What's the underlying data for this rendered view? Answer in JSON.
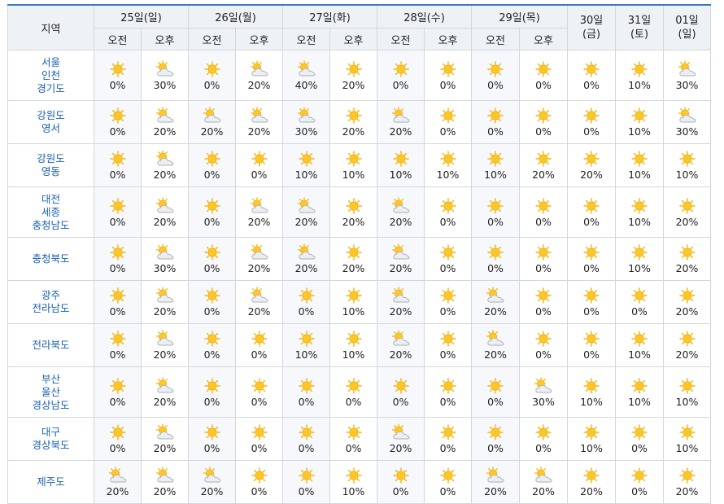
{
  "header": {
    "region_label": "지역",
    "days": [
      {
        "label": "25일(일)",
        "am": "오전",
        "pm": "오후"
      },
      {
        "label": "26일(월)",
        "am": "오전",
        "pm": "오후"
      },
      {
        "label": "27일(화)",
        "am": "오전",
        "pm": "오후"
      },
      {
        "label": "28일(수)",
        "am": "오전",
        "pm": "오후"
      },
      {
        "label": "29일(목)",
        "am": "오전",
        "pm": "오후"
      }
    ],
    "week_days": [
      {
        "top": "30일",
        "bottom": "(금)"
      },
      {
        "top": "31일",
        "bottom": "(토)"
      },
      {
        "top": "01일",
        "bottom": "(일)"
      }
    ]
  },
  "icon_legend": {
    "sun": "sunny-icon",
    "cloudsun": "partly-cloudy-icon"
  },
  "colors": {
    "accent": "#3a78c2",
    "region_text": "#1a5fb4",
    "sun": "#f5b700",
    "cloud": "#c8ccd2"
  },
  "rows": [
    {
      "region": [
        "서울",
        "인천",
        "경기도"
      ],
      "cells": [
        [
          "sun",
          "0%"
        ],
        [
          "cloudsun",
          "30%"
        ],
        [
          "sun",
          "0%"
        ],
        [
          "cloudsun",
          "20%"
        ],
        [
          "cloudsun",
          "40%"
        ],
        [
          "sun",
          "20%"
        ],
        [
          "sun",
          "0%"
        ],
        [
          "sun",
          "0%"
        ],
        [
          "sun",
          "0%"
        ],
        [
          "sun",
          "0%"
        ],
        [
          "sun",
          "0%"
        ],
        [
          "sun",
          "10%"
        ],
        [
          "cloudsun",
          "30%"
        ]
      ]
    },
    {
      "region": [
        "강원도",
        "영서"
      ],
      "cells": [
        [
          "sun",
          "0%"
        ],
        [
          "cloudsun",
          "20%"
        ],
        [
          "cloudsun",
          "20%"
        ],
        [
          "cloudsun",
          "20%"
        ],
        [
          "cloudsun",
          "30%"
        ],
        [
          "sun",
          "20%"
        ],
        [
          "cloudsun",
          "20%"
        ],
        [
          "sun",
          "0%"
        ],
        [
          "sun",
          "0%"
        ],
        [
          "sun",
          "0%"
        ],
        [
          "sun",
          "0%"
        ],
        [
          "sun",
          "10%"
        ],
        [
          "cloudsun",
          "30%"
        ]
      ]
    },
    {
      "region": [
        "강원도",
        "영동"
      ],
      "cells": [
        [
          "sun",
          "0%"
        ],
        [
          "cloudsun",
          "20%"
        ],
        [
          "sun",
          "0%"
        ],
        [
          "sun",
          "0%"
        ],
        [
          "sun",
          "10%"
        ],
        [
          "sun",
          "10%"
        ],
        [
          "sun",
          "10%"
        ],
        [
          "sun",
          "10%"
        ],
        [
          "sun",
          "10%"
        ],
        [
          "sun",
          "20%"
        ],
        [
          "sun",
          "20%"
        ],
        [
          "sun",
          "10%"
        ],
        [
          "sun",
          "10%"
        ]
      ]
    },
    {
      "region": [
        "대전",
        "세종",
        "충청남도"
      ],
      "cells": [
        [
          "sun",
          "0%"
        ],
        [
          "cloudsun",
          "20%"
        ],
        [
          "sun",
          "0%"
        ],
        [
          "cloudsun",
          "20%"
        ],
        [
          "cloudsun",
          "20%"
        ],
        [
          "sun",
          "20%"
        ],
        [
          "cloudsun",
          "20%"
        ],
        [
          "sun",
          "0%"
        ],
        [
          "sun",
          "0%"
        ],
        [
          "sun",
          "0%"
        ],
        [
          "sun",
          "0%"
        ],
        [
          "sun",
          "10%"
        ],
        [
          "sun",
          "20%"
        ]
      ]
    },
    {
      "region": [
        "충청북도"
      ],
      "cells": [
        [
          "sun",
          "0%"
        ],
        [
          "cloudsun",
          "30%"
        ],
        [
          "sun",
          "0%"
        ],
        [
          "cloudsun",
          "20%"
        ],
        [
          "cloudsun",
          "20%"
        ],
        [
          "sun",
          "20%"
        ],
        [
          "cloudsun",
          "20%"
        ],
        [
          "sun",
          "0%"
        ],
        [
          "sun",
          "0%"
        ],
        [
          "sun",
          "0%"
        ],
        [
          "sun",
          "0%"
        ],
        [
          "sun",
          "10%"
        ],
        [
          "sun",
          "20%"
        ]
      ]
    },
    {
      "region": [
        "광주",
        "전라남도"
      ],
      "cells": [
        [
          "sun",
          "0%"
        ],
        [
          "cloudsun",
          "20%"
        ],
        [
          "sun",
          "0%"
        ],
        [
          "cloudsun",
          "20%"
        ],
        [
          "sun",
          "0%"
        ],
        [
          "sun",
          "10%"
        ],
        [
          "cloudsun",
          "20%"
        ],
        [
          "sun",
          "0%"
        ],
        [
          "cloudsun",
          "20%"
        ],
        [
          "sun",
          "0%"
        ],
        [
          "sun",
          "0%"
        ],
        [
          "sun",
          "0%"
        ],
        [
          "sun",
          "20%"
        ]
      ]
    },
    {
      "region": [
        "전라북도"
      ],
      "cells": [
        [
          "sun",
          "0%"
        ],
        [
          "cloudsun",
          "20%"
        ],
        [
          "sun",
          "0%"
        ],
        [
          "sun",
          "0%"
        ],
        [
          "sun",
          "10%"
        ],
        [
          "sun",
          "10%"
        ],
        [
          "cloudsun",
          "20%"
        ],
        [
          "sun",
          "0%"
        ],
        [
          "cloudsun",
          "20%"
        ],
        [
          "sun",
          "0%"
        ],
        [
          "sun",
          "0%"
        ],
        [
          "sun",
          "10%"
        ],
        [
          "sun",
          "20%"
        ]
      ]
    },
    {
      "region": [
        "부산",
        "울산",
        "경상남도"
      ],
      "cells": [
        [
          "sun",
          "0%"
        ],
        [
          "cloudsun",
          "20%"
        ],
        [
          "sun",
          "0%"
        ],
        [
          "sun",
          "0%"
        ],
        [
          "sun",
          "0%"
        ],
        [
          "sun",
          "0%"
        ],
        [
          "sun",
          "0%"
        ],
        [
          "sun",
          "0%"
        ],
        [
          "sun",
          "0%"
        ],
        [
          "cloudsun",
          "30%"
        ],
        [
          "sun",
          "10%"
        ],
        [
          "sun",
          "10%"
        ],
        [
          "sun",
          "10%"
        ]
      ]
    },
    {
      "region": [
        "대구",
        "경상북도"
      ],
      "cells": [
        [
          "sun",
          "0%"
        ],
        [
          "cloudsun",
          "20%"
        ],
        [
          "sun",
          "0%"
        ],
        [
          "sun",
          "0%"
        ],
        [
          "sun",
          "0%"
        ],
        [
          "sun",
          "0%"
        ],
        [
          "cloudsun",
          "20%"
        ],
        [
          "sun",
          "0%"
        ],
        [
          "sun",
          "0%"
        ],
        [
          "sun",
          "0%"
        ],
        [
          "sun",
          "10%"
        ],
        [
          "sun",
          "0%"
        ],
        [
          "sun",
          "10%"
        ]
      ]
    },
    {
      "region": [
        "제주도"
      ],
      "cells": [
        [
          "cloudsun",
          "20%"
        ],
        [
          "cloudsun",
          "20%"
        ],
        [
          "cloudsun",
          "20%"
        ],
        [
          "sun",
          "0%"
        ],
        [
          "sun",
          "0%"
        ],
        [
          "sun",
          "10%"
        ],
        [
          "sun",
          "0%"
        ],
        [
          "sun",
          "0%"
        ],
        [
          "cloudsun",
          "20%"
        ],
        [
          "cloudsun",
          "20%"
        ],
        [
          "sun",
          "20%"
        ],
        [
          "sun",
          "0%"
        ],
        [
          "sun",
          "20%"
        ]
      ]
    }
  ]
}
